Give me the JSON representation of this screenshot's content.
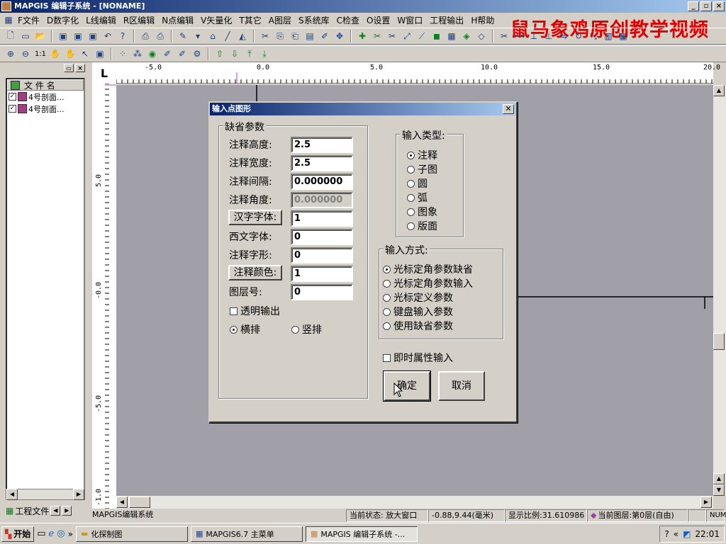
{
  "window": {
    "title": "MAPGIS 编辑子系统 - [NONAME]"
  },
  "menu": [
    "F文件",
    "D数字化",
    "L线编辑",
    "R区编辑",
    "N点编辑",
    "V矢量化",
    "T其它",
    "A图层",
    "S系统库",
    "C检查",
    "O设置",
    "W窗口",
    "工程输出",
    "H帮助"
  ],
  "watermark": "鼠马象鸡原创教学视频",
  "left_panel": {
    "column_header": "文 件 名",
    "files": [
      "4号剖面...",
      "4号剖面..."
    ],
    "tab_label": "工程文件"
  },
  "ruler": {
    "h_labels": [
      "-5.0",
      "0.0",
      "5.0",
      "10.0",
      "15.0",
      "20.0"
    ],
    "v_labels": [
      "5.0",
      "-0.0",
      "-5.0",
      "-1.0"
    ],
    "corner": "L"
  },
  "dialog": {
    "title": "输入点图形",
    "defaults_group": "缺省参数",
    "fields": [
      {
        "label": "注释高度:",
        "value": "2.5",
        "is_button": false,
        "disabled": false
      },
      {
        "label": "注释宽度:",
        "value": "2.5",
        "is_button": false,
        "disabled": false
      },
      {
        "label": "注释间隔:",
        "value": "0.000000",
        "is_button": false,
        "disabled": false
      },
      {
        "label": "注释角度:",
        "value": "0.000000",
        "is_button": false,
        "disabled": true
      },
      {
        "label": "汉字字体:",
        "value": "1",
        "is_button": true,
        "disabled": false
      },
      {
        "label": "西文字体:",
        "value": "0",
        "is_button": false,
        "disabled": false
      },
      {
        "label": "注释字形:",
        "value": "0",
        "is_button": false,
        "disabled": false
      },
      {
        "label": "注释颜色:",
        "value": "1",
        "is_button": true,
        "disabled": false
      },
      {
        "label": "图层号:",
        "value": "0",
        "is_button": false,
        "disabled": false
      }
    ],
    "transparent_output": "透明输出",
    "orientation": [
      {
        "label": "横排",
        "selected": true
      },
      {
        "label": "竖排",
        "selected": false
      }
    ],
    "input_type_group": "输入类型:",
    "input_types": [
      {
        "label": "注释",
        "selected": true
      },
      {
        "label": "子图",
        "selected": false
      },
      {
        "label": "圆",
        "selected": false
      },
      {
        "label": "弧",
        "selected": false
      },
      {
        "label": "图象",
        "selected": false
      },
      {
        "label": "版面",
        "selected": false
      }
    ],
    "input_method_group": "输入方式:",
    "input_methods": [
      {
        "label": "光标定角参数缺省",
        "selected": true
      },
      {
        "label": "光标定角参数输入",
        "selected": false
      },
      {
        "label": "光标定义参数",
        "selected": false
      },
      {
        "label": "键盘输入参数",
        "selected": false
      },
      {
        "label": "使用缺省参数",
        "selected": false
      }
    ],
    "attr_input": "即时属性输入",
    "ok": "确定",
    "cancel": "取消"
  },
  "status": {
    "app": "MAPGIS编辑系统",
    "state": "当前状态: 放大窗口",
    "coords": "-0.88,9.44(毫米)",
    "scale": "显示比例:31.610986",
    "layer": "当前图层:第0层(自由)",
    "num": "NUM"
  },
  "taskbar": {
    "start": "开始",
    "tasks": [
      "化探制图",
      "MAPGIS6.7 主菜单",
      "MAPGIS 编辑子系统 -..."
    ],
    "clock": "22:01"
  },
  "colors": {
    "title_start": "#0a246a",
    "title_end": "#a6caf0",
    "canvas": "#a19fa7",
    "watermark": "#e00000"
  }
}
